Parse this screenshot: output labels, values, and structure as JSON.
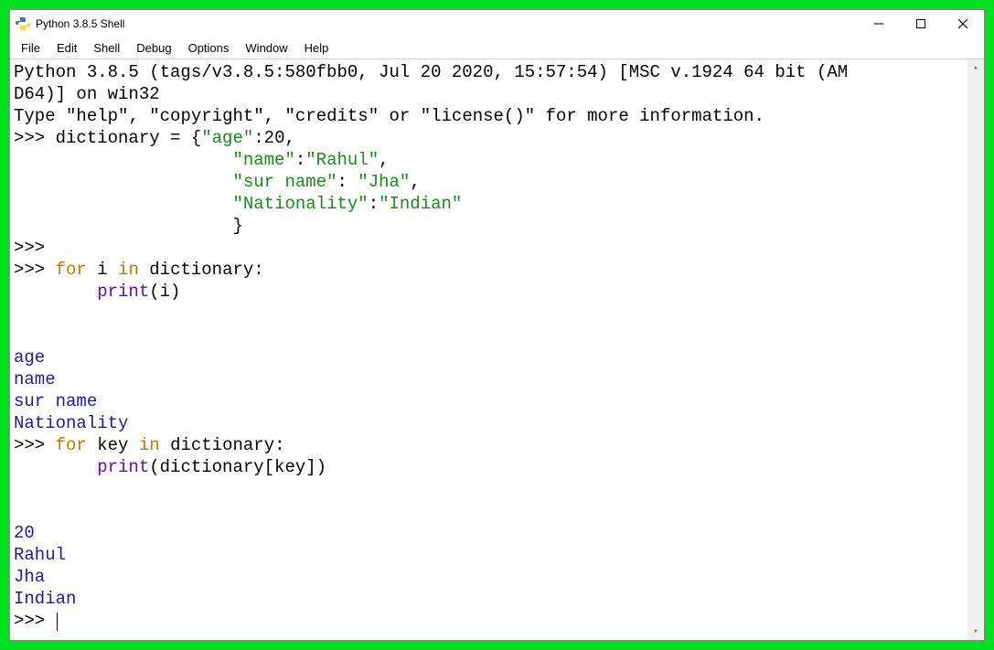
{
  "window": {
    "title": "Python 3.8.5 Shell"
  },
  "menus": [
    "File",
    "Edit",
    "Shell",
    "Debug",
    "Options",
    "Window",
    "Help"
  ],
  "banner": {
    "line1": "Python 3.8.5 (tags/v3.8.5:580fbb0, Jul 20 2020, 15:57:54) [MSC v.1924 64 bit (AM",
    "line2": "D64)] on win32",
    "line3_a": "Type ",
    "line3_b": "\"help\"",
    "line3_c": ", ",
    "line3_d": "\"copyright\"",
    "line3_e": ", ",
    "line3_f": "\"credits\"",
    "line3_g": " or ",
    "line3_h": "\"license()\"",
    "line3_i": " for more information."
  },
  "code": {
    "p": ">>> ",
    "p_empty": ">>>",
    "cont": "                     ",
    "indent": "        ",
    "l1a": "dictionary = {",
    "l1b": "\"age\"",
    "l1c": ":20,",
    "l2a": "\"name\"",
    "l2b": ":",
    "l2c": "\"Rahul\"",
    "l2d": ",",
    "l3a": "\"sur name\"",
    "l3b": ": ",
    "l3c": "\"Jha\"",
    "l3d": ",",
    "l4a": "\"Nationality\"",
    "l4b": ":",
    "l4c": "\"Indian\"",
    "l5": "}",
    "for_kw": "for",
    "in_kw": "in",
    "sp": " ",
    "i_var": "i",
    "key_var": "key",
    "dict_colon": " dictionary:",
    "print_fn": "print",
    "print_arg1": "(i)",
    "print_arg2": "(dictionary[key])",
    "blank": "        "
  },
  "output1": [
    "age",
    "name",
    "sur name",
    "Nationality"
  ],
  "output2": [
    "20",
    "Rahul",
    "Jha",
    "Indian"
  ]
}
